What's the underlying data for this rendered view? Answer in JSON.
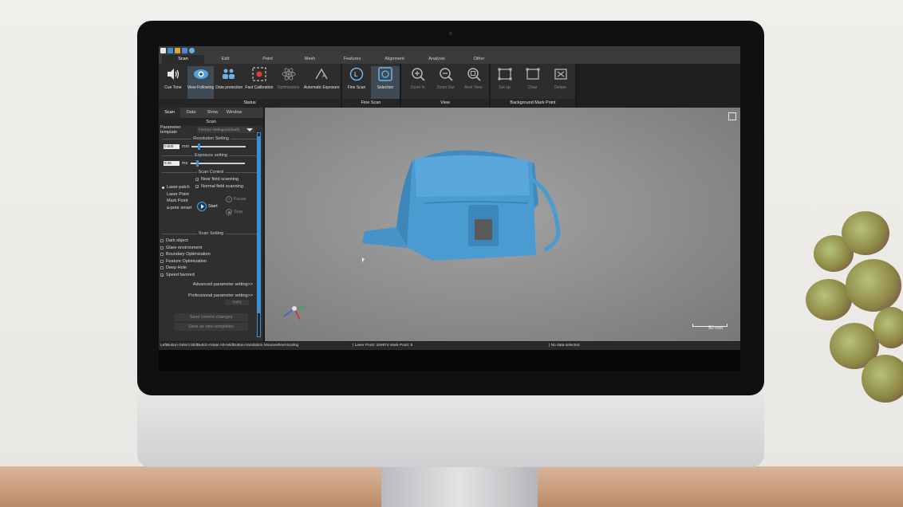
{
  "menu": [
    "Scan",
    "Edit",
    "Point",
    "Mesh",
    "Features",
    "Alignment",
    "Analysis",
    "Other"
  ],
  "ribbon": {
    "status": {
      "title": "Status",
      "buttons": [
        "Cue Tone",
        "View Following",
        "Data protection",
        "Fast Calibration",
        "Optimization",
        "Automatic Exposure"
      ]
    },
    "fine_scan": {
      "title": "Fine Scan",
      "buttons": [
        "Fine Scan",
        "Selection"
      ]
    },
    "view": {
      "title": "View",
      "buttons": [
        "Zoom In",
        "Zoom Out",
        "Best View"
      ]
    },
    "bg_mark": {
      "title": "Background Mark Point",
      "buttons": [
        "Set up",
        "Clear",
        "Delete"
      ]
    }
  },
  "panel": {
    "tabs": [
      "Scan",
      "Data",
      "Show",
      "Window"
    ],
    "header": "Scan",
    "param_template_label": "Parameter template",
    "param_template_value": "Factory settings(default)",
    "resolution_title": "Resolution Setting",
    "resolution_value": "0.500",
    "resolution_unit": "mm",
    "resolution_level": 0.12,
    "exposure_title": "Exposure setting",
    "exposure_value": "0.26",
    "exposure_unit": "ms",
    "exposure_level": 0.1,
    "scan_control_title": "Scan Control",
    "near_field": "Near field scanning",
    "normal_field": "Normal field scanning",
    "modes": [
      "Laser patch",
      "Laser Point",
      "Mark Point",
      "a-prior smart"
    ],
    "start": "Start",
    "pause": "Pause",
    "stop": "Stop",
    "scan_setting_title": "Scan Setting",
    "settings": [
      "Dark object",
      "Glare environment",
      "Boundary Optimization",
      "Feature Optimization",
      "Deep Hole",
      "Speed favored"
    ],
    "advanced": "Advanced parameter setting>>",
    "professional": "Professional parameter setting>>",
    "apply": "Apply",
    "save_current": "Save current changes",
    "save_new": "Save as new templates"
  },
  "viewport": {
    "scale_label": "50 mm",
    "axis_y": "Y"
  },
  "statusbar": {
    "hint": "LeftButton-Select MidButton-rotate Alt+MidButton-translation Mousewheel-scaling",
    "points": "| Laser Point: 326974  Mark Point: 9",
    "selection": "| No data selected"
  },
  "colors": {
    "accent": "#3b8fd7",
    "model": "#4a9bd1",
    "panel_bg": "#2f2f2f"
  }
}
